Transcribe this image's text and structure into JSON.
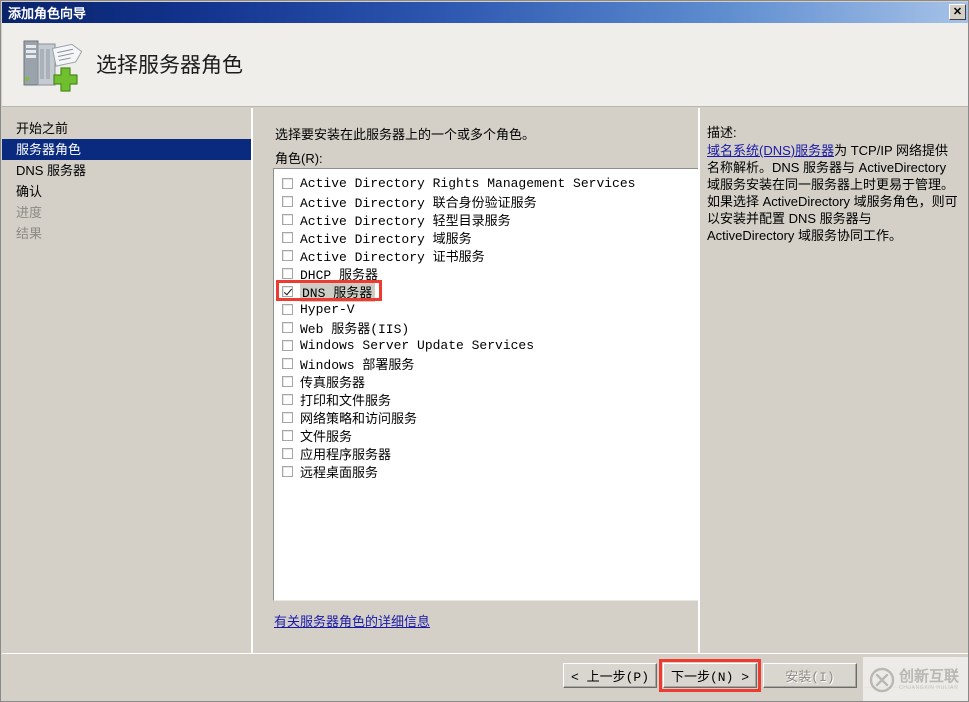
{
  "window": {
    "title": "添加角色向导",
    "close_label": "✕"
  },
  "header": {
    "title": "选择服务器角色",
    "icon": "server-add-icon"
  },
  "sidebar": {
    "items": [
      {
        "label": "开始之前",
        "state": "normal"
      },
      {
        "label": "服务器角色",
        "state": "selected"
      },
      {
        "label": "DNS 服务器",
        "state": "normal"
      },
      {
        "label": "确认",
        "state": "normal"
      },
      {
        "label": "进度",
        "state": "disabled"
      },
      {
        "label": "结果",
        "state": "disabled"
      }
    ]
  },
  "main": {
    "instruction": "选择要安装在此服务器上的一个或多个角色。",
    "roles_label": "角色(R):",
    "details_link": "有关服务器角色的详细信息",
    "roles": [
      {
        "label": "Active Directory Rights Management Services",
        "checked": false,
        "selected": false
      },
      {
        "label": "Active Directory 联合身份验证服务",
        "checked": false,
        "selected": false
      },
      {
        "label": "Active Directory 轻型目录服务",
        "checked": false,
        "selected": false
      },
      {
        "label": "Active Directory 域服务",
        "checked": false,
        "selected": false
      },
      {
        "label": "Active Directory 证书服务",
        "checked": false,
        "selected": false
      },
      {
        "label": "DHCP 服务器",
        "checked": false,
        "selected": false
      },
      {
        "label": "DNS 服务器",
        "checked": true,
        "selected": true,
        "highlight": true
      },
      {
        "label": "Hyper-V",
        "checked": false,
        "selected": false
      },
      {
        "label": "Web 服务器(IIS)",
        "checked": false,
        "selected": false
      },
      {
        "label": "Windows Server Update Services",
        "checked": false,
        "selected": false
      },
      {
        "label": "Windows 部署服务",
        "checked": false,
        "selected": false
      },
      {
        "label": "传真服务器",
        "checked": false,
        "selected": false
      },
      {
        "label": "打印和文件服务",
        "checked": false,
        "selected": false
      },
      {
        "label": "网络策略和访问服务",
        "checked": false,
        "selected": false
      },
      {
        "label": "文件服务",
        "checked": false,
        "selected": false
      },
      {
        "label": "应用程序服务器",
        "checked": false,
        "selected": false
      },
      {
        "label": "远程桌面服务",
        "checked": false,
        "selected": false
      }
    ]
  },
  "description": {
    "title": "描述:",
    "link_text": "域名系统(DNS)服务器",
    "body": "为 TCP/IP 网络提供名称解析。DNS 服务器与 ActiveDirectory 域服务安装在同一服务器上时更易于管理。如果选择 ActiveDirectory 域服务角色，则可以安装并配置 DNS 服务器与 ActiveDirectory 域服务协同工作。"
  },
  "footer": {
    "back_label": "< 上一步(P)",
    "next_label": "下一步(N) >",
    "install_label": "安装(I)",
    "cancel_label": ""
  },
  "watermark": {
    "main": "创新互联",
    "sub": "CHUANGXIN HULIAN",
    "logo": "cx-circle-logo"
  },
  "colors": {
    "titlebar_start": "#0a246a",
    "titlebar_end": "#a7c2e8",
    "sidebar_selected": "#0a2a80",
    "link": "#1a1aa8",
    "annotation_red": "#ee3b30",
    "dialog_face": "#d4d0c8"
  }
}
